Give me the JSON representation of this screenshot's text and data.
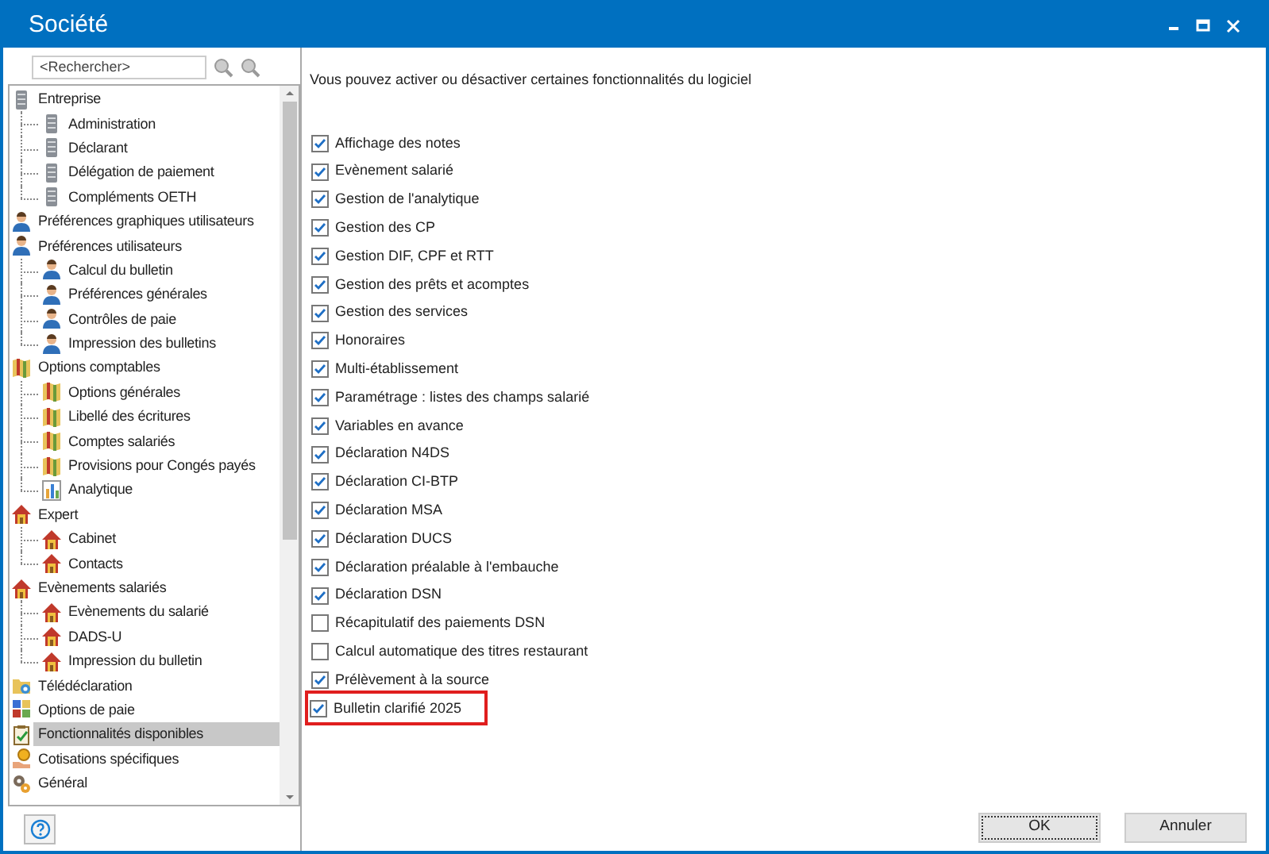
{
  "window": {
    "title": "Société"
  },
  "search": {
    "placeholder": "<Rechercher>"
  },
  "tree": [
    {
      "label": "Entreprise",
      "kind": "server",
      "selected": false,
      "children": [
        {
          "label": "Administration",
          "kind": "server",
          "selected": false
        },
        {
          "label": "Déclarant",
          "kind": "server",
          "selected": false
        },
        {
          "label": "Délégation de paiement",
          "kind": "server",
          "selected": false
        },
        {
          "label": "Compléments OETH",
          "kind": "server",
          "selected": false
        }
      ]
    },
    {
      "label": "Préférences graphiques utilisateurs",
      "kind": "user",
      "selected": false
    },
    {
      "label": "Préférences utilisateurs",
      "kind": "user",
      "selected": false,
      "children": [
        {
          "label": "Calcul du bulletin",
          "kind": "user",
          "selected": false
        },
        {
          "label": "Préférences générales",
          "kind": "user",
          "selected": false
        },
        {
          "label": "Contrôles de paie",
          "kind": "user",
          "selected": false
        },
        {
          "label": "Impression des bulletins",
          "kind": "user",
          "selected": false
        }
      ]
    },
    {
      "label": "Options comptables",
      "kind": "map",
      "selected": false,
      "children": [
        {
          "label": "Options générales",
          "kind": "map",
          "selected": false
        },
        {
          "label": "Libellé des écritures",
          "kind": "map",
          "selected": false
        },
        {
          "label": "Comptes salariés",
          "kind": "map",
          "selected": false
        },
        {
          "label": "Provisions pour Congés payés",
          "kind": "map",
          "selected": false
        },
        {
          "label": "Analytique",
          "kind": "chart",
          "selected": false
        }
      ]
    },
    {
      "label": "Expert",
      "kind": "house",
      "selected": false,
      "children": [
        {
          "label": "Cabinet",
          "kind": "house",
          "selected": false
        },
        {
          "label": "Contacts",
          "kind": "house",
          "selected": false
        }
      ]
    },
    {
      "label": "Evènements salariés",
      "kind": "house",
      "selected": false,
      "children": [
        {
          "label": "Evènements du salarié",
          "kind": "house",
          "selected": false
        },
        {
          "label": "DADS-U",
          "kind": "house",
          "selected": false
        },
        {
          "label": "Impression du bulletin",
          "kind": "house",
          "selected": false
        }
      ]
    },
    {
      "label": "Télédéclaration",
      "kind": "folder",
      "selected": false
    },
    {
      "label": "Options de paie",
      "kind": "grid",
      "selected": false
    },
    {
      "label": "Fonctionnalités disponibles",
      "kind": "clipboard",
      "selected": true
    },
    {
      "label": "Cotisations spécifiques",
      "kind": "coin",
      "selected": false
    },
    {
      "label": "Général",
      "kind": "gears",
      "selected": false
    }
  ],
  "intro": "Vous pouvez activer ou désactiver certaines fonctionnalités du logiciel",
  "features": [
    {
      "label": "Affichage des notes",
      "checked": true,
      "highlighted": false
    },
    {
      "label": "Evènement salarié",
      "checked": true,
      "highlighted": false
    },
    {
      "label": "Gestion de l'analytique",
      "checked": true,
      "highlighted": false
    },
    {
      "label": "Gestion des CP",
      "checked": true,
      "highlighted": false
    },
    {
      "label": "Gestion DIF, CPF et RTT",
      "checked": true,
      "highlighted": false
    },
    {
      "label": "Gestion des prêts et acomptes",
      "checked": true,
      "highlighted": false
    },
    {
      "label": "Gestion des services",
      "checked": true,
      "highlighted": false
    },
    {
      "label": "Honoraires",
      "checked": true,
      "highlighted": false
    },
    {
      "label": "Multi-établissement",
      "checked": true,
      "highlighted": false
    },
    {
      "label": "Paramétrage : listes des champs salarié",
      "checked": true,
      "highlighted": false
    },
    {
      "label": "Variables en avance",
      "checked": true,
      "highlighted": false
    },
    {
      "label": "Déclaration N4DS",
      "checked": true,
      "highlighted": false
    },
    {
      "label": "Déclaration CI-BTP",
      "checked": true,
      "highlighted": false
    },
    {
      "label": "Déclaration MSA",
      "checked": true,
      "highlighted": false
    },
    {
      "label": "Déclaration DUCS",
      "checked": true,
      "highlighted": false
    },
    {
      "label": "Déclaration préalable à l'embauche",
      "checked": true,
      "highlighted": false
    },
    {
      "label": "Déclaration DSN",
      "checked": true,
      "highlighted": false
    },
    {
      "label": "Récapitulatif des paiements DSN",
      "checked": false,
      "highlighted": false
    },
    {
      "label": "Calcul automatique des titres restaurant",
      "checked": false,
      "highlighted": false
    },
    {
      "label": "Prélèvement à la source",
      "checked": true,
      "highlighted": false
    },
    {
      "label": "Bulletin clarifié 2025",
      "checked": true,
      "highlighted": true
    }
  ],
  "buttons": [
    {
      "label": "OK",
      "focused": true
    },
    {
      "label": "Annuler",
      "focused": false
    }
  ]
}
